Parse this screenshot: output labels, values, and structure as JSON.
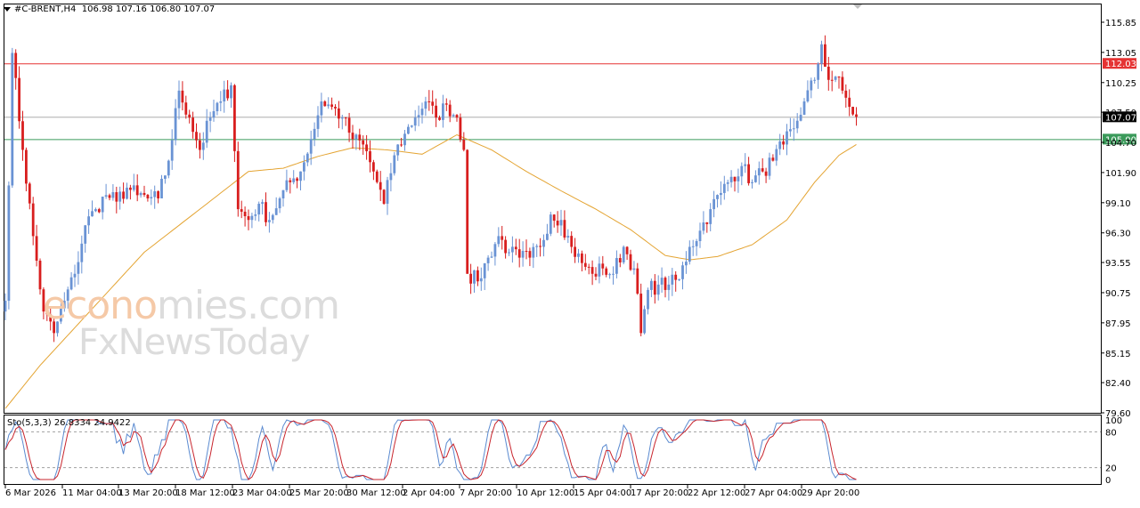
{
  "symbol": "#C-BRENT,H4",
  "ohlc_text": "106.98 107.16 106.80 107.07",
  "stochastic": {
    "label": "Sto(5,3,3) 26.8334 24.9422",
    "levels": [
      100,
      80,
      20,
      0
    ]
  },
  "watermark": {
    "part1": "econo",
    "part2": "mies.com",
    "line2": "FxNewsToday"
  },
  "colors": {
    "bull": "#6a93d4",
    "bear": "#d81e1e",
    "ma": "#e4a432",
    "resistance": "#e53333",
    "support": "#3a9a5a",
    "stoch_main": "#5a8ad0",
    "stoch_signal": "#c8252d",
    "current": "#a0a0a0"
  },
  "chart_data": {
    "type": "candlestick",
    "symbol": "#C-BRENT",
    "timeframe": "H4",
    "ylim": [
      79.6,
      117.5
    ],
    "y_ticks": [
      "115.85",
      "113.05",
      "112.03",
      "110.25",
      "107.50",
      "107.07",
      "105.00",
      "104.70",
      "101.90",
      "99.10",
      "96.30",
      "93.55",
      "90.75",
      "87.95",
      "85.15",
      "82.40",
      "79.60"
    ],
    "x_ticks": [
      "6 Mar 2026",
      "11 Mar 04:00",
      "13 Mar 20:00",
      "18 Mar 12:00",
      "23 Mar 04:00",
      "25 Mar 20:00",
      "30 Mar 12:00",
      "2 Apr 04:00",
      "7 Apr 20:00",
      "10 Apr 12:00",
      "15 Apr 04:00",
      "17 Apr 20:00",
      "22 Apr 12:00",
      "27 Apr 04:00",
      "29 Apr 20:00"
    ],
    "levels": [
      {
        "name": "resistance",
        "value": 112.03,
        "label": "112.03"
      },
      {
        "name": "current",
        "value": 107.07,
        "label": "107.07"
      },
      {
        "name": "support",
        "value": 105.0,
        "label": "105.00"
      }
    ],
    "close_anchors": [
      [
        0,
        90.0
      ],
      [
        2,
        113.0
      ],
      [
        5,
        104.0
      ],
      [
        8,
        96.0
      ],
      [
        11,
        89.0
      ],
      [
        14,
        87.0
      ],
      [
        17,
        90.0
      ],
      [
        20,
        92.5
      ],
      [
        23,
        97.0
      ],
      [
        26,
        98.5
      ],
      [
        29,
        99.8
      ],
      [
        32,
        99.2
      ],
      [
        35,
        100.5
      ],
      [
        38,
        99.8
      ],
      [
        41,
        99.5
      ],
      [
        44,
        99.5
      ],
      [
        47,
        103.0
      ],
      [
        50,
        109.5
      ],
      [
        53,
        107.0
      ],
      [
        56,
        104.0
      ],
      [
        59,
        107.0
      ],
      [
        62,
        108.5
      ],
      [
        65,
        110.0
      ],
      [
        67,
        98.5
      ],
      [
        70,
        97.5
      ],
      [
        73,
        99.0
      ],
      [
        76,
        97.5
      ],
      [
        79,
        99.5
      ],
      [
        82,
        101.0
      ],
      [
        85,
        102.0
      ],
      [
        88,
        105.0
      ],
      [
        91,
        108.5
      ],
      [
        94,
        108.0
      ],
      [
        97,
        107.0
      ],
      [
        100,
        105.0
      ],
      [
        103,
        104.5
      ],
      [
        106,
        102.0
      ],
      [
        109,
        99.0
      ],
      [
        112,
        103.5
      ],
      [
        115,
        105.5
      ],
      [
        118,
        107.0
      ],
      [
        121,
        108.5
      ],
      [
        124,
        107.0
      ],
      [
        127,
        108.2
      ],
      [
        130,
        107.0
      ],
      [
        132,
        104.0
      ],
      [
        133,
        92.5
      ],
      [
        136,
        91.8
      ],
      [
        139,
        94.0
      ],
      [
        142,
        96.0
      ],
      [
        145,
        94.5
      ],
      [
        148,
        94.0
      ],
      [
        151,
        94.0
      ],
      [
        154,
        95.0
      ],
      [
        157,
        98.0
      ],
      [
        160,
        97.5
      ],
      [
        163,
        95.0
      ],
      [
        166,
        93.5
      ],
      [
        169,
        92.5
      ],
      [
        172,
        93.0
      ],
      [
        175,
        92.5
      ],
      [
        178,
        95.0
      ],
      [
        181,
        93.0
      ],
      [
        183,
        87.0
      ],
      [
        185,
        91.0
      ],
      [
        188,
        91.5
      ],
      [
        191,
        91.5
      ],
      [
        194,
        92.0
      ],
      [
        197,
        95.0
      ],
      [
        200,
        96.5
      ],
      [
        203,
        98.5
      ],
      [
        206,
        100.0
      ],
      [
        209,
        101.5
      ],
      [
        212,
        102.5
      ],
      [
        215,
        101.0
      ],
      [
        218,
        102.0
      ],
      [
        221,
        103.0
      ],
      [
        224,
        104.5
      ],
      [
        227,
        106.0
      ],
      [
        230,
        108.5
      ],
      [
        233,
        110.5
      ],
      [
        235,
        113.8
      ],
      [
        237,
        110.5
      ],
      [
        239,
        110.8
      ],
      [
        241,
        109.5
      ],
      [
        243,
        108.0
      ],
      [
        245,
        107.07
      ]
    ],
    "ma_anchors": [
      [
        0,
        80.0
      ],
      [
        10,
        84.0
      ],
      [
        20,
        87.5
      ],
      [
        30,
        91.0
      ],
      [
        40,
        94.5
      ],
      [
        50,
        97.0
      ],
      [
        60,
        99.5
      ],
      [
        70,
        102.0
      ],
      [
        80,
        102.3
      ],
      [
        90,
        103.4
      ],
      [
        100,
        104.2
      ],
      [
        110,
        104.0
      ],
      [
        120,
        103.6
      ],
      [
        130,
        105.4
      ],
      [
        140,
        104.0
      ],
      [
        150,
        102.0
      ],
      [
        160,
        100.2
      ],
      [
        170,
        98.5
      ],
      [
        180,
        96.6
      ],
      [
        190,
        94.2
      ],
      [
        197,
        93.8
      ],
      [
        205,
        94.1
      ],
      [
        215,
        95.2
      ],
      [
        225,
        97.5
      ],
      [
        233,
        101.0
      ],
      [
        240,
        103.5
      ],
      [
        245,
        104.5
      ]
    ]
  }
}
